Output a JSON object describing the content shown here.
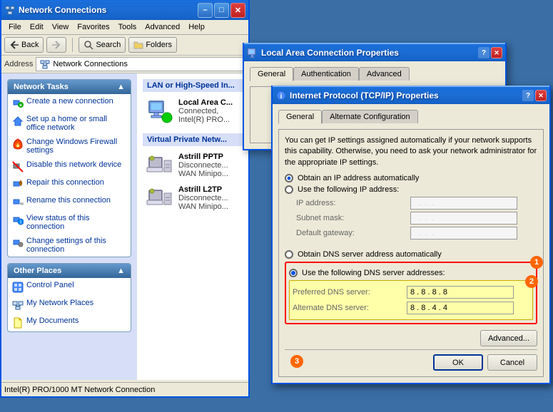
{
  "main_window": {
    "title": "Network Connections",
    "menu": [
      "File",
      "Edit",
      "View",
      "Favorites",
      "Tools",
      "Advanced",
      "Help"
    ],
    "toolbar": {
      "back": "Back",
      "search": "Search",
      "folders": "Folders"
    },
    "address": "Network Connections",
    "sidebar": {
      "network_tasks_title": "Network Tasks",
      "items": [
        {
          "label": "Create a new connection",
          "icon": "new-conn"
        },
        {
          "label": "Set up a home or small office network",
          "icon": "home-network"
        },
        {
          "label": "Change Windows Firewall settings",
          "icon": "firewall"
        },
        {
          "label": "Disable this network device",
          "icon": "disable"
        },
        {
          "label": "Repair this connection",
          "icon": "repair"
        },
        {
          "label": "Rename this connection",
          "icon": "rename"
        },
        {
          "label": "View status of this connection",
          "icon": "status"
        },
        {
          "label": "Change settings of this connection",
          "icon": "settings"
        }
      ],
      "other_places_title": "Other Places",
      "other_places": [
        {
          "label": "Control Panel"
        },
        {
          "label": "My Network Places"
        },
        {
          "label": "My Documents"
        }
      ]
    },
    "content": {
      "lan_section": "LAN or High-Speed In...",
      "lan_item": {
        "name": "Local Area C...",
        "status": "Connected,",
        "detail": "Intel(R) PRO..."
      },
      "vpn_section": "Virtual Private Netw...",
      "vpn_items": [
        {
          "name": "Astrill PPTP",
          "status": "Disconnecte...",
          "detail": "WAN Minipo..."
        },
        {
          "name": "Astrill L2TP",
          "status": "Disconnecte...",
          "detail": "WAN Minipo..."
        }
      ]
    },
    "status_bar": "Intel(R) PRO/1000 MT Network Connection"
  },
  "lan_dialog": {
    "title": "Local Area Connection Properties",
    "tabs": [
      "General",
      "Authentication",
      "Advanced"
    ],
    "active_tab": "General"
  },
  "tcpip_dialog": {
    "title": "Internet Protocol (TCP/IP) Properties",
    "tabs": [
      "General",
      "Alternate Configuration"
    ],
    "active_tab": "General",
    "description": "You can get IP settings assigned automatically if your network supports this capability. Otherwise, you need to ask your network administrator for the appropriate IP settings.",
    "ip_section": {
      "auto_ip_label": "Obtain an IP address automatically",
      "manual_ip_label": "Use the following IP address:",
      "ip_address_label": "IP address:",
      "subnet_label": "Subnet mask:",
      "gateway_label": "Default gateway:",
      "ip_address_value": "",
      "subnet_value": "",
      "gateway_value": ""
    },
    "dns_section": {
      "auto_dns_label": "Obtain DNS server address automatically",
      "manual_dns_label": "Use the following DNS server addresses:",
      "preferred_label": "Preferred DNS server:",
      "alternate_label": "Alternate DNS server:",
      "preferred_value": "8 . 8 . 8 . 8",
      "alternate_value": "8 . 8 . 4 . 4"
    },
    "buttons": {
      "advanced": "Advanced...",
      "ok": "OK",
      "cancel": "Cancel"
    },
    "badge1": "1",
    "badge2": "2",
    "badge3": "3"
  }
}
